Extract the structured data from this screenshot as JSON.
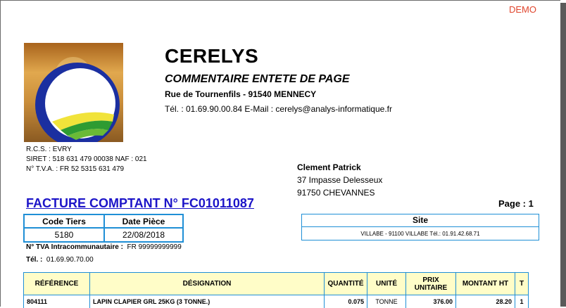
{
  "watermark": "DEMO",
  "company": {
    "name": "CERELYS",
    "header_comment": "COMMENTAIRE ENTETE DE PAGE",
    "address": "Rue de Tournenfils  -  91540  MENNECY",
    "contact": "Tél. : 01.69.90.00.84  E-Mail : cerelys@analys-informatique.fr",
    "legal": {
      "rcs": "R.C.S. : EVRY",
      "siret": "SIRET : 518 631 479 00038  NAF : 021",
      "tva": "N° T.V.A. : FR 52 5315 631 479"
    }
  },
  "client": {
    "name": "Clement Patrick",
    "street": "37 Impasse Delesseux",
    "city": "91750 CHEVANNES"
  },
  "document": {
    "title": "FACTURE COMPTANT N° FC01011087",
    "page": "Page : 1"
  },
  "meta": {
    "code_tiers_label": "Code Tiers",
    "date_piece_label": "Date Pièce",
    "code_tiers": "5180",
    "date_piece": "22/08/2018"
  },
  "site": {
    "label": "Site",
    "value": "VILLABE - 91100 VILLABE Tél.: 01.91.42.68.71"
  },
  "intracom": {
    "label": "N° TVA Intracommunautaire :",
    "value": "FR 99999999999",
    "tel_label": "Tél. :",
    "tel_value": "01.69.90.70.00"
  },
  "lines": {
    "headers": {
      "reference": "RÉFÉRENCE",
      "designation": "DÉSIGNATION",
      "quantite": "QUANTITÉ",
      "unite": "UNITÉ",
      "prix_unitaire": "PRIX UNITAIRE",
      "montant_ht": "MONTANT HT",
      "t": "T"
    },
    "rows": [
      {
        "reference": "804111",
        "designation": "LAPIN CLAPIER GRL 25KG (3 TONNE.)",
        "quantite": "0.075",
        "unite": "TONNE",
        "prix_unitaire": "376.00",
        "montant_ht": "28.20",
        "t": "1"
      }
    ]
  },
  "colors": {
    "border_blue": "#1f8fd6",
    "title_blue": "#1c14c8",
    "header_yellow": "#fffdc8",
    "demo_red": "#e0462e"
  }
}
